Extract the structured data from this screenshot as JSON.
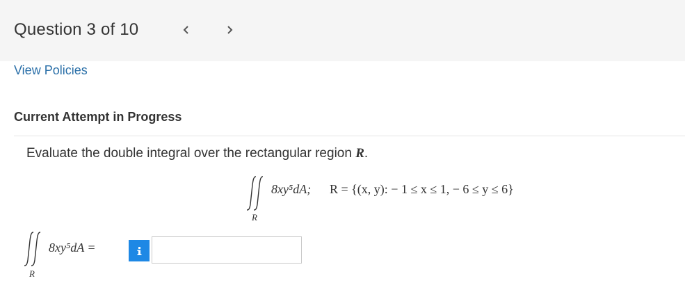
{
  "header": {
    "question_label": "Question 3 of 10",
    "prev_icon": "chevron-left-icon",
    "next_icon": "chevron-right-icon"
  },
  "links": {
    "view_policies": "View Policies"
  },
  "status": {
    "attempt": "Current Attempt in Progress"
  },
  "question": {
    "prompt_text": "Evaluate the double integral over the rectangular region",
    "prompt_var": "R",
    "prompt_end": ".",
    "display_integrand": "8xy⁵dA;",
    "display_region": "R = {(x, y): − 1 ≤ x ≤ 1, − 6 ≤ y ≤ 6}",
    "display_subscript": "R"
  },
  "answer": {
    "integrand": "8xy⁵dA =",
    "subscript": "R",
    "info_icon": "info-icon",
    "value": ""
  },
  "colors": {
    "accent": "#1e88e5",
    "link": "#2a6fa8",
    "topbar": "#f5f5f5"
  }
}
